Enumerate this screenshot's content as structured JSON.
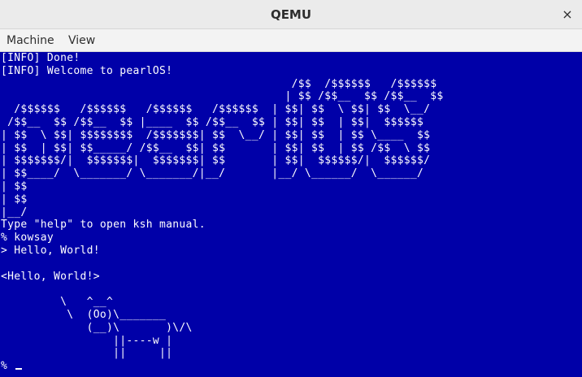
{
  "window": {
    "title": "QEMU",
    "close_glyph": "×"
  },
  "menu": {
    "items": [
      "Machine",
      "View"
    ]
  },
  "console": {
    "lines": [
      "[INFO] Done!",
      "[INFO] Welcome to pearlOS!",
      "                                            /$$  /$$$$$$   /$$$$$$ ",
      "                                           | $$ /$$__  $$ /$$__  $$",
      "  /$$$$$$   /$$$$$$   /$$$$$$   /$$$$$$  | $$| $$  \\ $$| $$  \\__/",
      " /$$__  $$ /$$__  $$ |____  $$ /$$__  $$ | $$| $$  | $$|  $$$$$$ ",
      "| $$  \\ $$| $$$$$$$$  /$$$$$$$| $$  \\__/ | $$| $$  | $$ \\____  $$",
      "| $$  | $$| $$_____/ /$$__  $$| $$       | $$| $$  | $$ /$$  \\ $$",
      "| $$$$$$$/|  $$$$$$$|  $$$$$$$| $$       | $$|  $$$$$$/|  $$$$$$/",
      "| $$____/  \\_______/ \\_______/|__/       |__/ \\______/  \\______/ ",
      "| $$",
      "| $$",
      "|__/",
      "Type \"help\" to open ksh manual.",
      "% kowsay",
      "> Hello, World!",
      "",
      "<Hello, World!>",
      "",
      "         \\   ^__^",
      "          \\  (Oo)\\_______",
      "             (__)\\       )\\/\\",
      "                 ||----w |",
      "                 ||     ||",
      "% "
    ]
  }
}
